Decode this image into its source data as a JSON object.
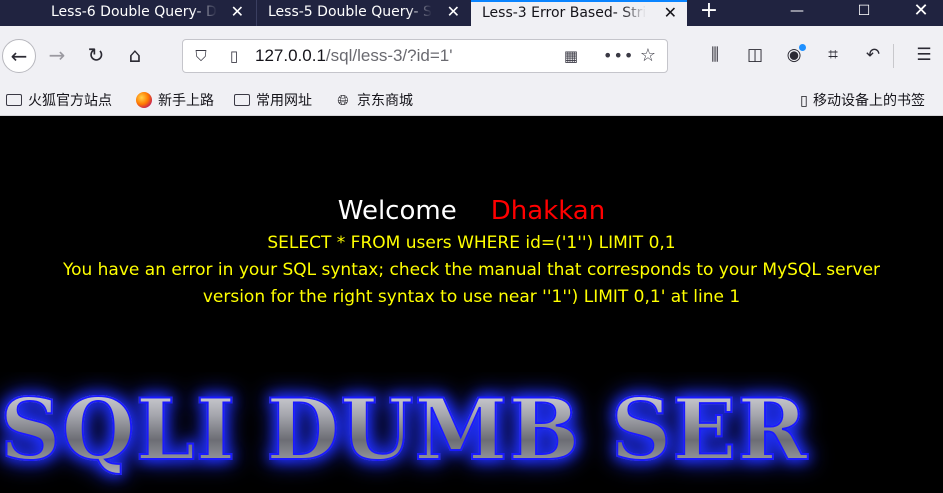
{
  "browser": {
    "tabs": [
      {
        "title": "Less-6 Double Query- D",
        "active": false
      },
      {
        "title": "Less-5 Double Query- S",
        "active": false
      },
      {
        "title": "Less-3 Error Based- Stri",
        "active": true
      }
    ],
    "url": {
      "host": "127.0.0.1",
      "path": "/sql/less-3/?id=1'"
    },
    "bookmarks": [
      {
        "label": "火狐官方站点",
        "icon": "folder-icon"
      },
      {
        "label": "新手上路",
        "icon": "firefox-icon"
      },
      {
        "label": "常用网址",
        "icon": "folder-icon"
      },
      {
        "label": "京东商城",
        "icon": "globe-icon"
      }
    ],
    "mobile_bookmarks": "移动设备上的书签"
  },
  "page": {
    "welcome": "Welcome",
    "username": "Dhakkan",
    "query": "SELECT * FROM users WHERE id=('1'') LIMIT 0,1",
    "error_line1": "You have an error in your SQL syntax; check the manual that corresponds to your MySQL server",
    "error_line2": "version for the right syntax to use near ''1'') LIMIT 0,1' at line 1",
    "banner": "SQLI DUMB SER"
  },
  "colors": {
    "background": "#000000",
    "username": "#ff0000",
    "error_text": "#ffff00",
    "tabbar": "#202340",
    "accent": "#0a84ff"
  }
}
